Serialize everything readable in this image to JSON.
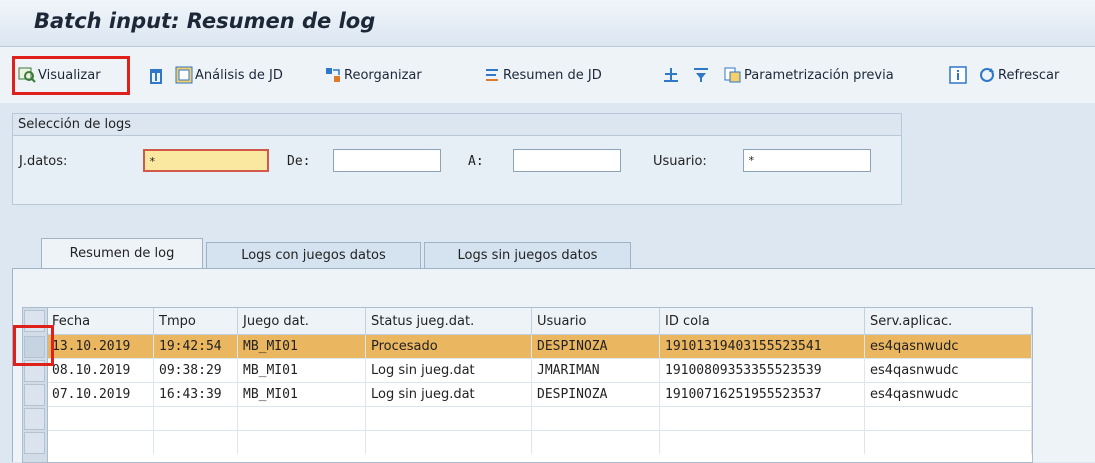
{
  "title": "Batch input: Resumen de log",
  "toolbar": {
    "visualizar": "Visualizar",
    "analisis": "Análisis de JD",
    "reorganizar": "Reorganizar",
    "resumen": "Resumen de JD",
    "parametrizacion": "Parametrización previa",
    "refrescar": "Refrescar"
  },
  "selection": {
    "title": "Selección de logs",
    "jdatos_label": "J.datos:",
    "jdatos_value": "*",
    "de_label": "De:",
    "de_value": "",
    "a_label": "A:",
    "a_value": "",
    "usuario_label": "Usuario:",
    "usuario_value": "*"
  },
  "tabs": [
    "Resumen de log",
    "Logs con juegos datos",
    "Logs sin juegos datos"
  ],
  "table": {
    "headers": [
      "Fecha",
      "Tmpo",
      "Juego dat.",
      "Status jueg.dat.",
      "Usuario",
      "ID cola",
      "Serv.aplicac."
    ],
    "rows": [
      [
        "13.10.2019",
        "19:42:54",
        "MB_MI01",
        "Procesado",
        "DESPINOZA",
        "19101319403155523541",
        "es4qasnwudc"
      ],
      [
        "08.10.2019",
        "09:38:29",
        "MB_MI01",
        "Log sin jueg.dat",
        "JMARIMAN",
        "19100809353355523539",
        "es4qasnwudc"
      ],
      [
        "07.10.2019",
        "16:43:39",
        "MB_MI01",
        "Log sin jueg.dat",
        "DESPINOZA",
        "19100716251955523537",
        "es4qasnwudc"
      ]
    ]
  },
  "colors": {
    "selected_row": "#eab65f",
    "highlight": "#e0211b"
  }
}
